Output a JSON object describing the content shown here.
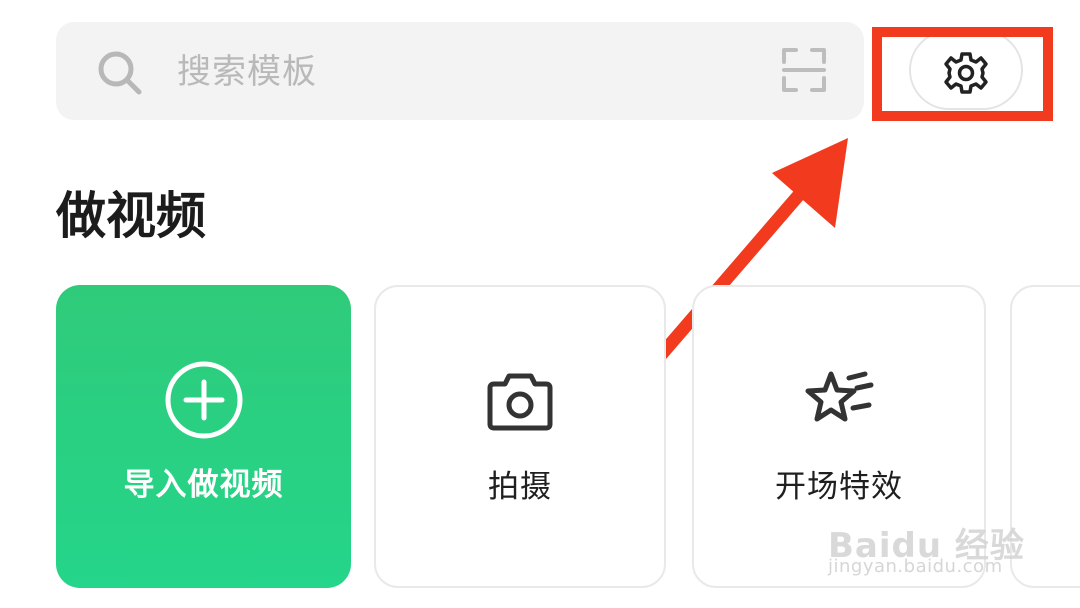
{
  "search": {
    "placeholder": "搜索模板",
    "icon": "search-icon",
    "scan_icon": "scan-icon"
  },
  "settings": {
    "icon": "gear-icon"
  },
  "annotation": {
    "color": "#f13a1e"
  },
  "section": {
    "title": "做视频"
  },
  "tiles": [
    {
      "label": "导入做视频",
      "icon": "plus-circle-icon",
      "accent": "#2fcb7a"
    },
    {
      "label": "拍摄",
      "icon": "camera-icon"
    },
    {
      "label": "开场特效",
      "icon": "star-icon"
    }
  ],
  "watermark": {
    "logo": "Baidu 经验",
    "url": "jingyan.baidu.com"
  }
}
